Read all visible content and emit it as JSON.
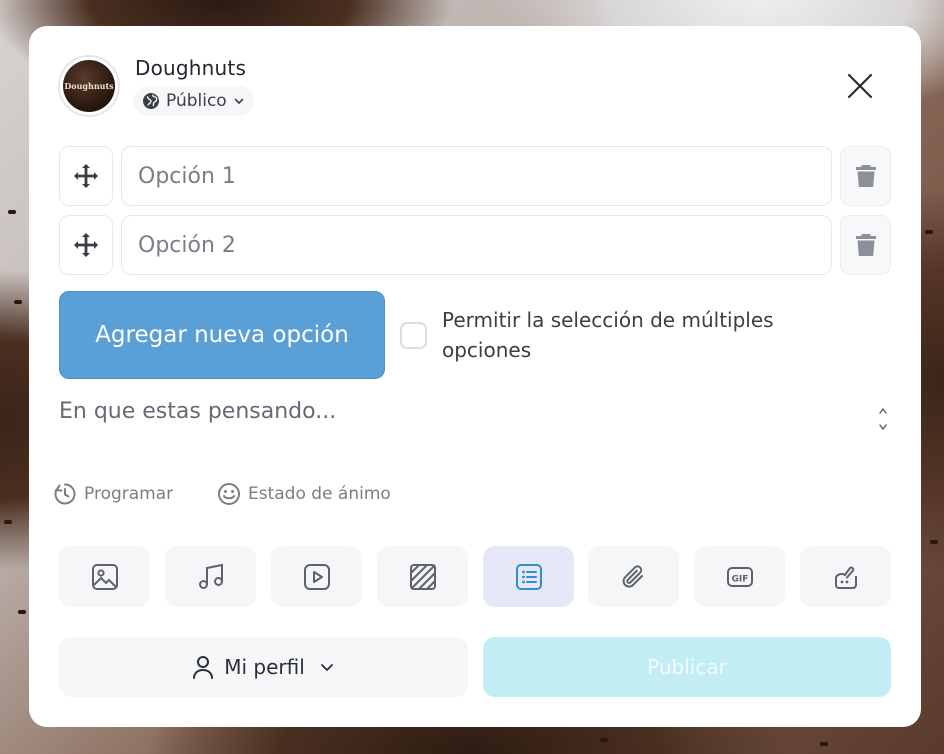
{
  "header": {
    "avatar_text": "Doughnuts",
    "page_name": "Doughnuts",
    "privacy_label": "Público"
  },
  "poll": {
    "options": [
      {
        "placeholder": "Opción 1",
        "value": ""
      },
      {
        "placeholder": "Opción 2",
        "value": ""
      }
    ],
    "add_option_label": "Agregar nueva opción",
    "multi_select_label": "Permitir la selección de múltiples opciones",
    "multi_select_checked": false
  },
  "composer": {
    "placeholder": "En que estas pensando...",
    "value": ""
  },
  "meta": {
    "schedule_label": "Programar",
    "mood_label": "Estado de ánimo"
  },
  "media_buttons": [
    {
      "icon": "image-icon"
    },
    {
      "icon": "music-icon"
    },
    {
      "icon": "video-icon"
    },
    {
      "icon": "pattern-icon"
    },
    {
      "icon": "poll-list-icon",
      "active": true
    },
    {
      "icon": "attachment-icon"
    },
    {
      "icon": "gif-icon"
    },
    {
      "icon": "sticker-icon"
    }
  ],
  "footer": {
    "profile_label": "Mi perfil",
    "publish_label": "Publicar"
  },
  "colors": {
    "accent_button": "#5a9fd6",
    "publish_disabled": "#c3edf4",
    "active_media": "#e6e8f7"
  }
}
